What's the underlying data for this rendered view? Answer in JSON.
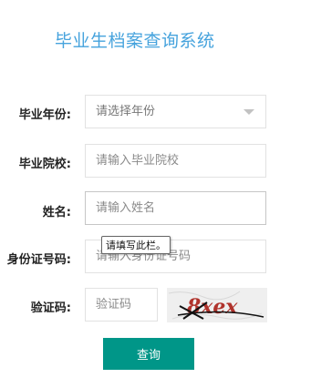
{
  "title": "毕业生档案查询系统",
  "form": {
    "year": {
      "label": "毕业年份:",
      "placeholder": "请选择年份"
    },
    "school": {
      "label": "毕业院校:",
      "placeholder": "请输入毕业院校"
    },
    "name": {
      "label": "姓名:",
      "placeholder": "请输入姓名"
    },
    "id_number": {
      "label": "身份证号码:",
      "placeholder": "请输入身份证号码"
    },
    "captcha": {
      "label": "验证码:",
      "placeholder": "验证码",
      "image_text": "8xex"
    },
    "submit_label": "查询"
  },
  "tooltip": "请填写此栏。",
  "colors": {
    "title": "#46a3dd",
    "button": "#009688",
    "captcha_text": "#b0332c"
  },
  "icons": {
    "select_caret": "chevron-down-icon"
  }
}
